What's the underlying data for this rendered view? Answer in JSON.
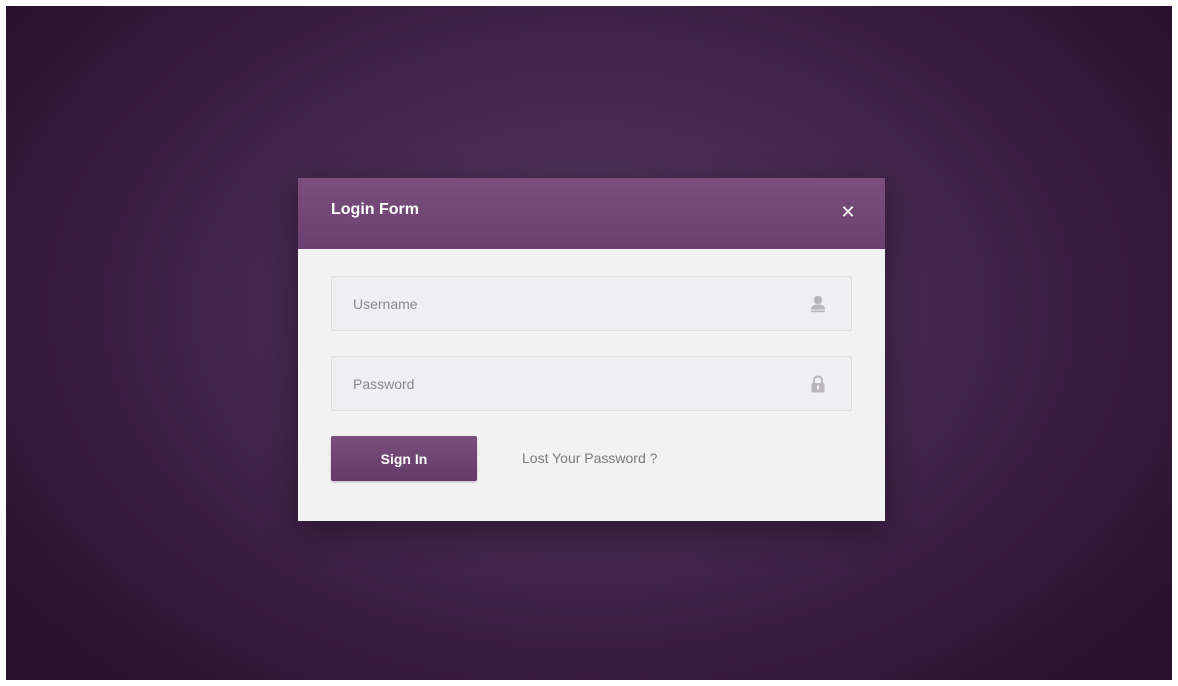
{
  "dialog": {
    "title": "Login Form",
    "close_label": "✕"
  },
  "form": {
    "username": {
      "placeholder": "Username",
      "value": "",
      "icon": "user-icon"
    },
    "password": {
      "placeholder": "Password",
      "value": "",
      "icon": "lock-icon"
    },
    "signin_label": "Sign In",
    "lost_password_label": "Lost Your Password ?"
  },
  "colors": {
    "accent": "#6f4574",
    "background": "#4a2a52",
    "panel": "#f3f2f3"
  }
}
